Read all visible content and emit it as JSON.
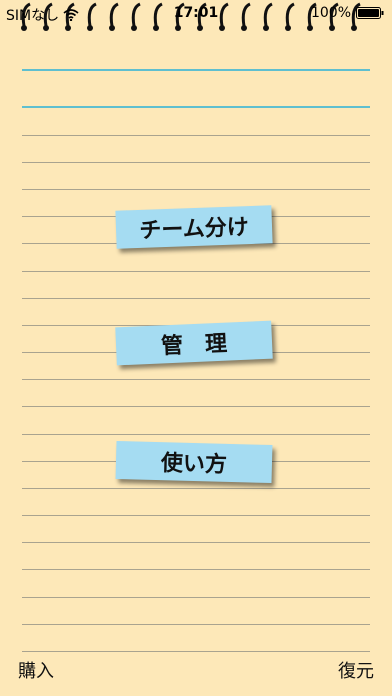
{
  "status_bar": {
    "carrier": "SIMなし",
    "time": "17:01",
    "battery": "100%"
  },
  "menu": {
    "team_split": "チーム分け",
    "manage": "管理",
    "usage": "使い方"
  },
  "toolbar": {
    "purchase": "購入",
    "restore": "復元"
  },
  "colors": {
    "paper": "#fde8b8",
    "note": "#a5dcf2",
    "header_line": "#5fbfcf",
    "ruled_line": "#a9a38f"
  },
  "icons": {
    "wifi": "wifi-icon",
    "battery": "battery-icon",
    "spiral": "spiral-binding"
  }
}
